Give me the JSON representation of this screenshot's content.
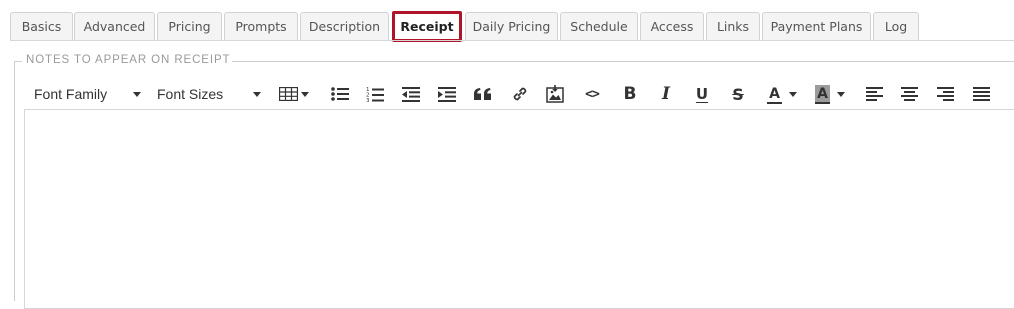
{
  "tabs": [
    {
      "label": "Basics",
      "active": false
    },
    {
      "label": "Advanced",
      "active": false
    },
    {
      "label": "Pricing",
      "active": false
    },
    {
      "label": "Prompts",
      "active": false
    },
    {
      "label": "Description",
      "active": false
    },
    {
      "label": "Receipt",
      "active": true
    },
    {
      "label": "Daily Pricing",
      "active": false
    },
    {
      "label": "Schedule",
      "active": false
    },
    {
      "label": "Access",
      "active": false
    },
    {
      "label": "Links",
      "active": false
    },
    {
      "label": "Payment Plans",
      "active": false
    },
    {
      "label": "Log",
      "active": false
    }
  ],
  "section": {
    "legend": "NOTES TO APPEAR ON RECEIPT"
  },
  "toolbar": {
    "font_family_label": "Font Family",
    "font_sizes_label": "Font Sizes",
    "icons": [
      "table-icon",
      "unordered-list-icon",
      "ordered-list-icon",
      "outdent-icon",
      "indent-icon",
      "blockquote-icon",
      "link-icon",
      "image-icon",
      "code-view-icon",
      "bold-icon",
      "italic-icon",
      "underline-icon",
      "strikethrough-icon",
      "font-color-icon",
      "background-color-icon",
      "align-left-icon",
      "align-center-icon",
      "align-right-icon",
      "align-justify-icon"
    ],
    "glyphs": {
      "bold": "B",
      "italic": "I",
      "underline": "U",
      "strike": "S",
      "font_color": "A",
      "bg_color": "A",
      "code": "<>"
    }
  },
  "colors": {
    "active_tab_border": "#b0142a",
    "tab_bg": "#f4f4f4",
    "legend": "#9a9a9a"
  },
  "editor": {
    "content": ""
  }
}
